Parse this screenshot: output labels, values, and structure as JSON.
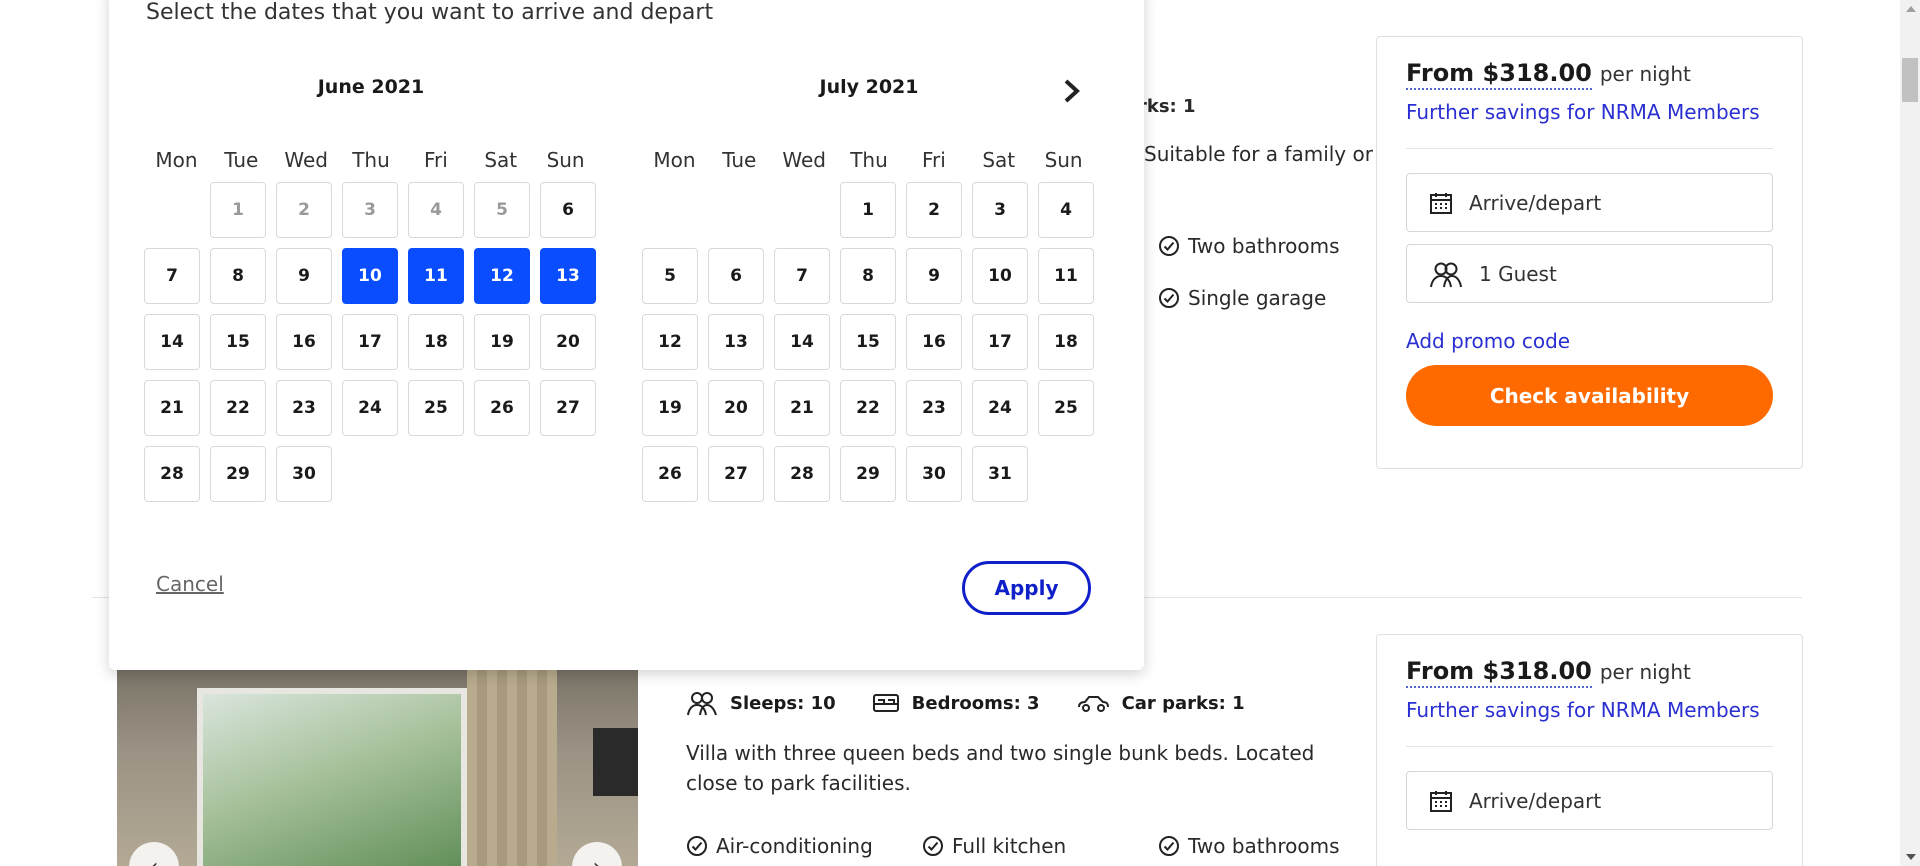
{
  "picker": {
    "title": "Select the dates that you want to arrive and depart",
    "next_icon": "chevron-right-icon",
    "weekdays": [
      "Mon",
      "Tue",
      "Wed",
      "Thu",
      "Fri",
      "Sat",
      "Sun"
    ],
    "months": [
      {
        "title": "June 2021",
        "leading_blanks": 1,
        "days": 30,
        "past_days": [
          1,
          2,
          3,
          4,
          5
        ],
        "selected_days": [
          10,
          11,
          12,
          13
        ]
      },
      {
        "title": "July 2021",
        "leading_blanks": 3,
        "days": 31,
        "past_days": [],
        "selected_days": []
      }
    ],
    "cancel_label": "Cancel",
    "apply_label": "Apply",
    "selected_color": "#0a4dff"
  },
  "listing_top": {
    "car_parks_fragment": "rks: 1",
    "description_fragment": "Suitable for a family or",
    "amenities": [
      "Two bathrooms",
      "Single garage"
    ]
  },
  "listing_bottom": {
    "specs": [
      {
        "icon": "guests-icon",
        "label": "Sleeps: 10"
      },
      {
        "icon": "bed-icon",
        "label": "Bedrooms: 3"
      },
      {
        "icon": "car-icon",
        "label": "Car parks: 1"
      }
    ],
    "description": "Villa with three queen beds and two single bunk beds. Located close to park facilities.",
    "amenities": [
      "Air-conditioning",
      "Full kitchen",
      "Two bathrooms"
    ]
  },
  "card_top": {
    "price": "From $318.00",
    "per": "per night",
    "savings": "Further savings for NRMA Members",
    "dates_field": "Arrive/depart",
    "guests_field": "1 Guest",
    "promo": "Add promo code",
    "cta": "Check availability",
    "cta_color": "#ff6a00"
  },
  "card_bottom": {
    "price": "From $318.00",
    "per": "per night",
    "savings": "Further savings for NRMA Members",
    "dates_field": "Arrive/depart"
  }
}
